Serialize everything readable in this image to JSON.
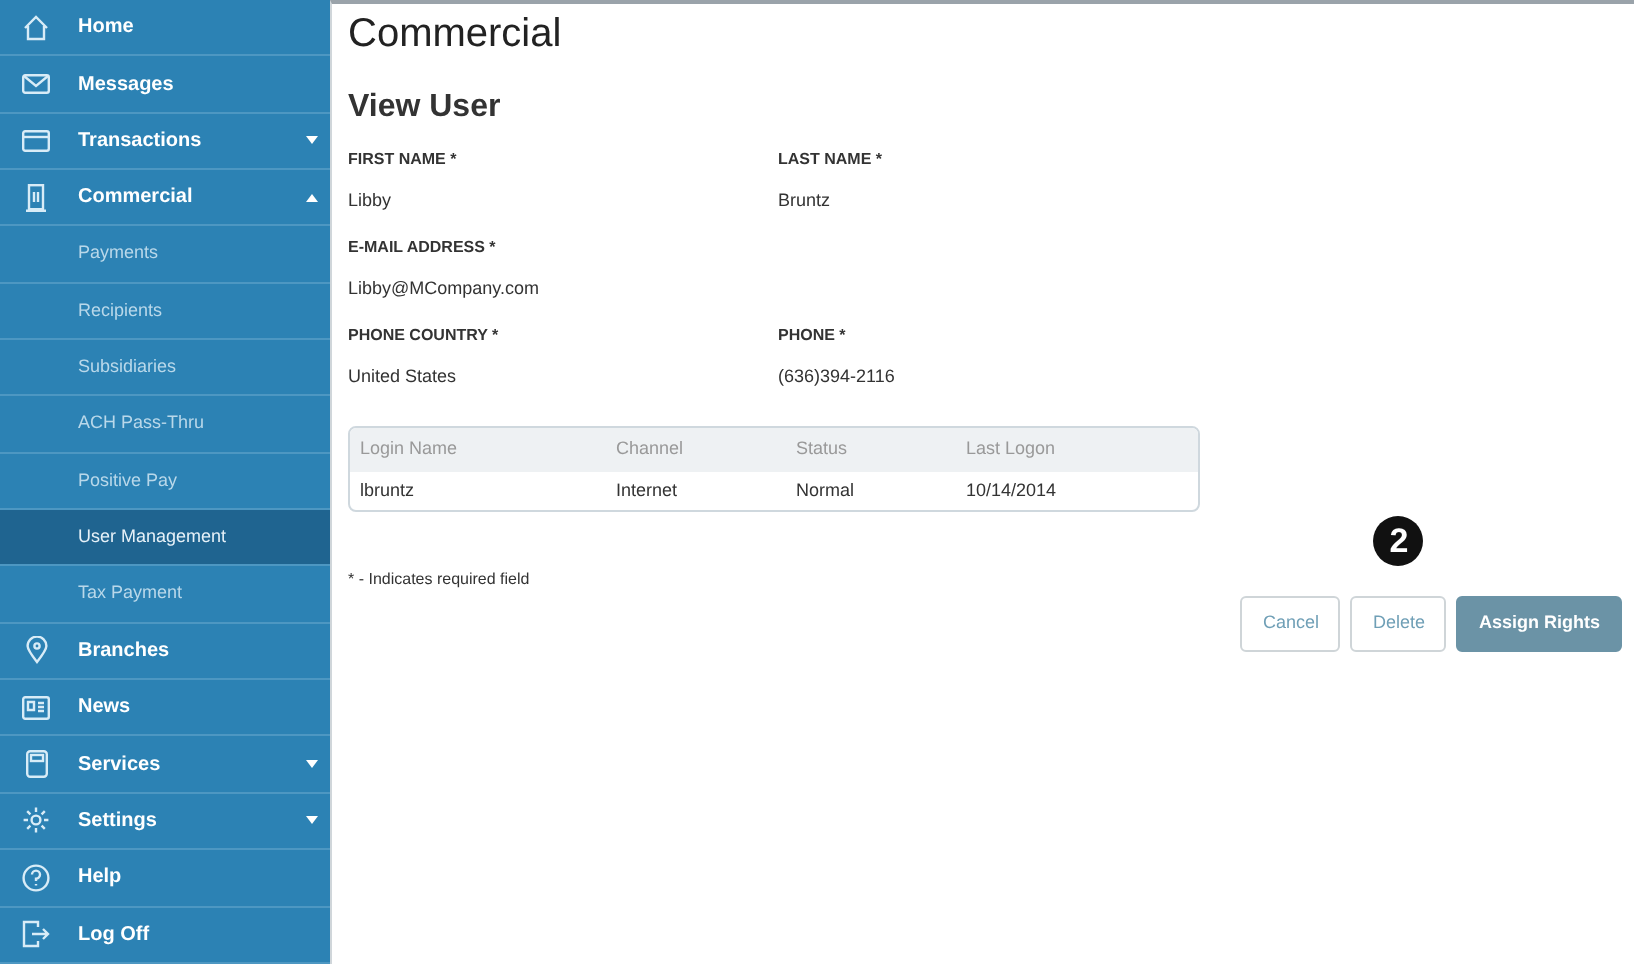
{
  "sidebar": {
    "items": [
      {
        "kind": "main",
        "label": "Home"
      },
      {
        "kind": "main",
        "label": "Messages"
      },
      {
        "kind": "main",
        "label": "Transactions",
        "expanded": false
      },
      {
        "kind": "main",
        "label": "Commercial",
        "expanded": true
      },
      {
        "kind": "sub",
        "label": "Payments",
        "selected": false
      },
      {
        "kind": "sub",
        "label": "Recipients",
        "selected": false
      },
      {
        "kind": "sub",
        "label": "Subsidiaries",
        "selected": false
      },
      {
        "kind": "sub",
        "label": "ACH Pass-Thru",
        "selected": false
      },
      {
        "kind": "sub",
        "label": "Positive Pay",
        "selected": false
      },
      {
        "kind": "sub",
        "label": "User Management",
        "selected": true
      },
      {
        "kind": "sub",
        "label": "Tax Payment",
        "selected": false
      },
      {
        "kind": "main",
        "label": "Branches"
      },
      {
        "kind": "main",
        "label": "News"
      },
      {
        "kind": "main",
        "label": "Services",
        "expanded": false
      },
      {
        "kind": "main",
        "label": "Settings",
        "expanded": false
      },
      {
        "kind": "main",
        "label": "Help"
      },
      {
        "kind": "main",
        "label": "Log Off"
      }
    ]
  },
  "page": {
    "title": "Commercial",
    "heading": "View User",
    "fields": [
      {
        "label": "FIRST NAME *",
        "value": "Libby"
      },
      {
        "label": "LAST NAME *",
        "value": "Bruntz"
      },
      {
        "label": "E-MAIL ADDRESS *",
        "value": "Libby@MCompany.com"
      },
      {
        "label": "PHONE COUNTRY *",
        "value": "United States"
      },
      {
        "label": "PHONE *",
        "value": "(636)394-2116"
      }
    ],
    "table": {
      "columns": [
        "Login Name",
        "Channel",
        "Status",
        "Last Logon"
      ],
      "rows": [
        [
          "lbruntz",
          "Internet",
          "Normal",
          "10/14/2014"
        ]
      ]
    },
    "note": "* - Indicates required field",
    "callout": "2",
    "buttons": [
      {
        "label": "Cancel",
        "kind": "secondary"
      },
      {
        "label": "Delete",
        "kind": "secondary"
      },
      {
        "label": "Assign Rights",
        "kind": "primary"
      }
    ]
  }
}
